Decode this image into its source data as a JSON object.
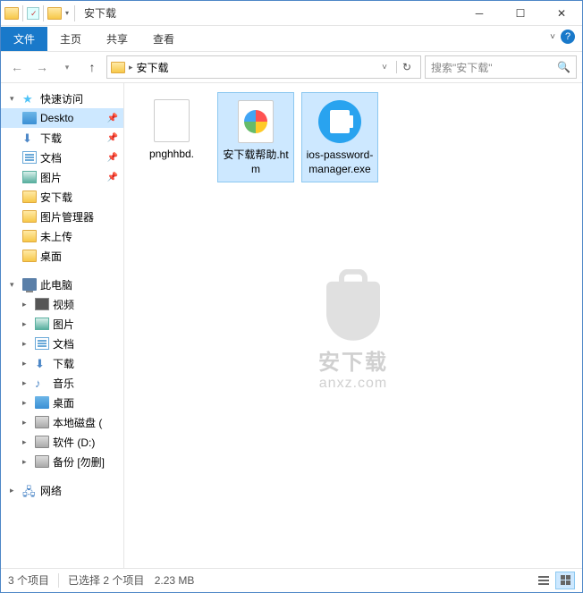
{
  "title": "安下载",
  "ribbon": {
    "file": "文件",
    "tabs": [
      "主页",
      "共享",
      "查看"
    ]
  },
  "breadcrumb": {
    "location": "安下载",
    "search_placeholder": "搜索\"安下载\""
  },
  "sidebar": {
    "quick": {
      "label": "快速访问",
      "items": [
        {
          "label": "Deskto",
          "selected": true,
          "pin": true,
          "icon": "desktop"
        },
        {
          "label": "下载",
          "pin": true,
          "icon": "download"
        },
        {
          "label": "文档",
          "pin": true,
          "icon": "doc"
        },
        {
          "label": "图片",
          "pin": true,
          "icon": "pic"
        },
        {
          "label": "安下载",
          "icon": "folder"
        },
        {
          "label": "图片管理器",
          "icon": "folder"
        },
        {
          "label": "未上传",
          "icon": "folder"
        },
        {
          "label": "桌面",
          "icon": "folder"
        }
      ]
    },
    "pc": {
      "label": "此电脑",
      "items": [
        {
          "label": "视频",
          "icon": "video"
        },
        {
          "label": "图片",
          "icon": "pic"
        },
        {
          "label": "文档",
          "icon": "doc"
        },
        {
          "label": "下载",
          "icon": "download"
        },
        {
          "label": "音乐",
          "icon": "music"
        },
        {
          "label": "桌面",
          "icon": "desktop"
        },
        {
          "label": "本地磁盘 (",
          "icon": "drive"
        },
        {
          "label": "软件 (D:)",
          "icon": "drive"
        },
        {
          "label": "备份 [勿删]",
          "icon": "drive"
        }
      ]
    },
    "network": {
      "label": "网络"
    }
  },
  "files": [
    {
      "name": "pnghhbd.",
      "type": "blank",
      "selected": false
    },
    {
      "name": "安下载帮助.htm",
      "type": "htm",
      "selected": true
    },
    {
      "name": "ios-password-manager.exe",
      "type": "exe",
      "selected": true
    }
  ],
  "watermark": {
    "line1": "安下载",
    "line2": "anxz.com"
  },
  "status": {
    "count": "3 个项目",
    "selection": "已选择 2 个项目",
    "size": "2.23 MB"
  }
}
